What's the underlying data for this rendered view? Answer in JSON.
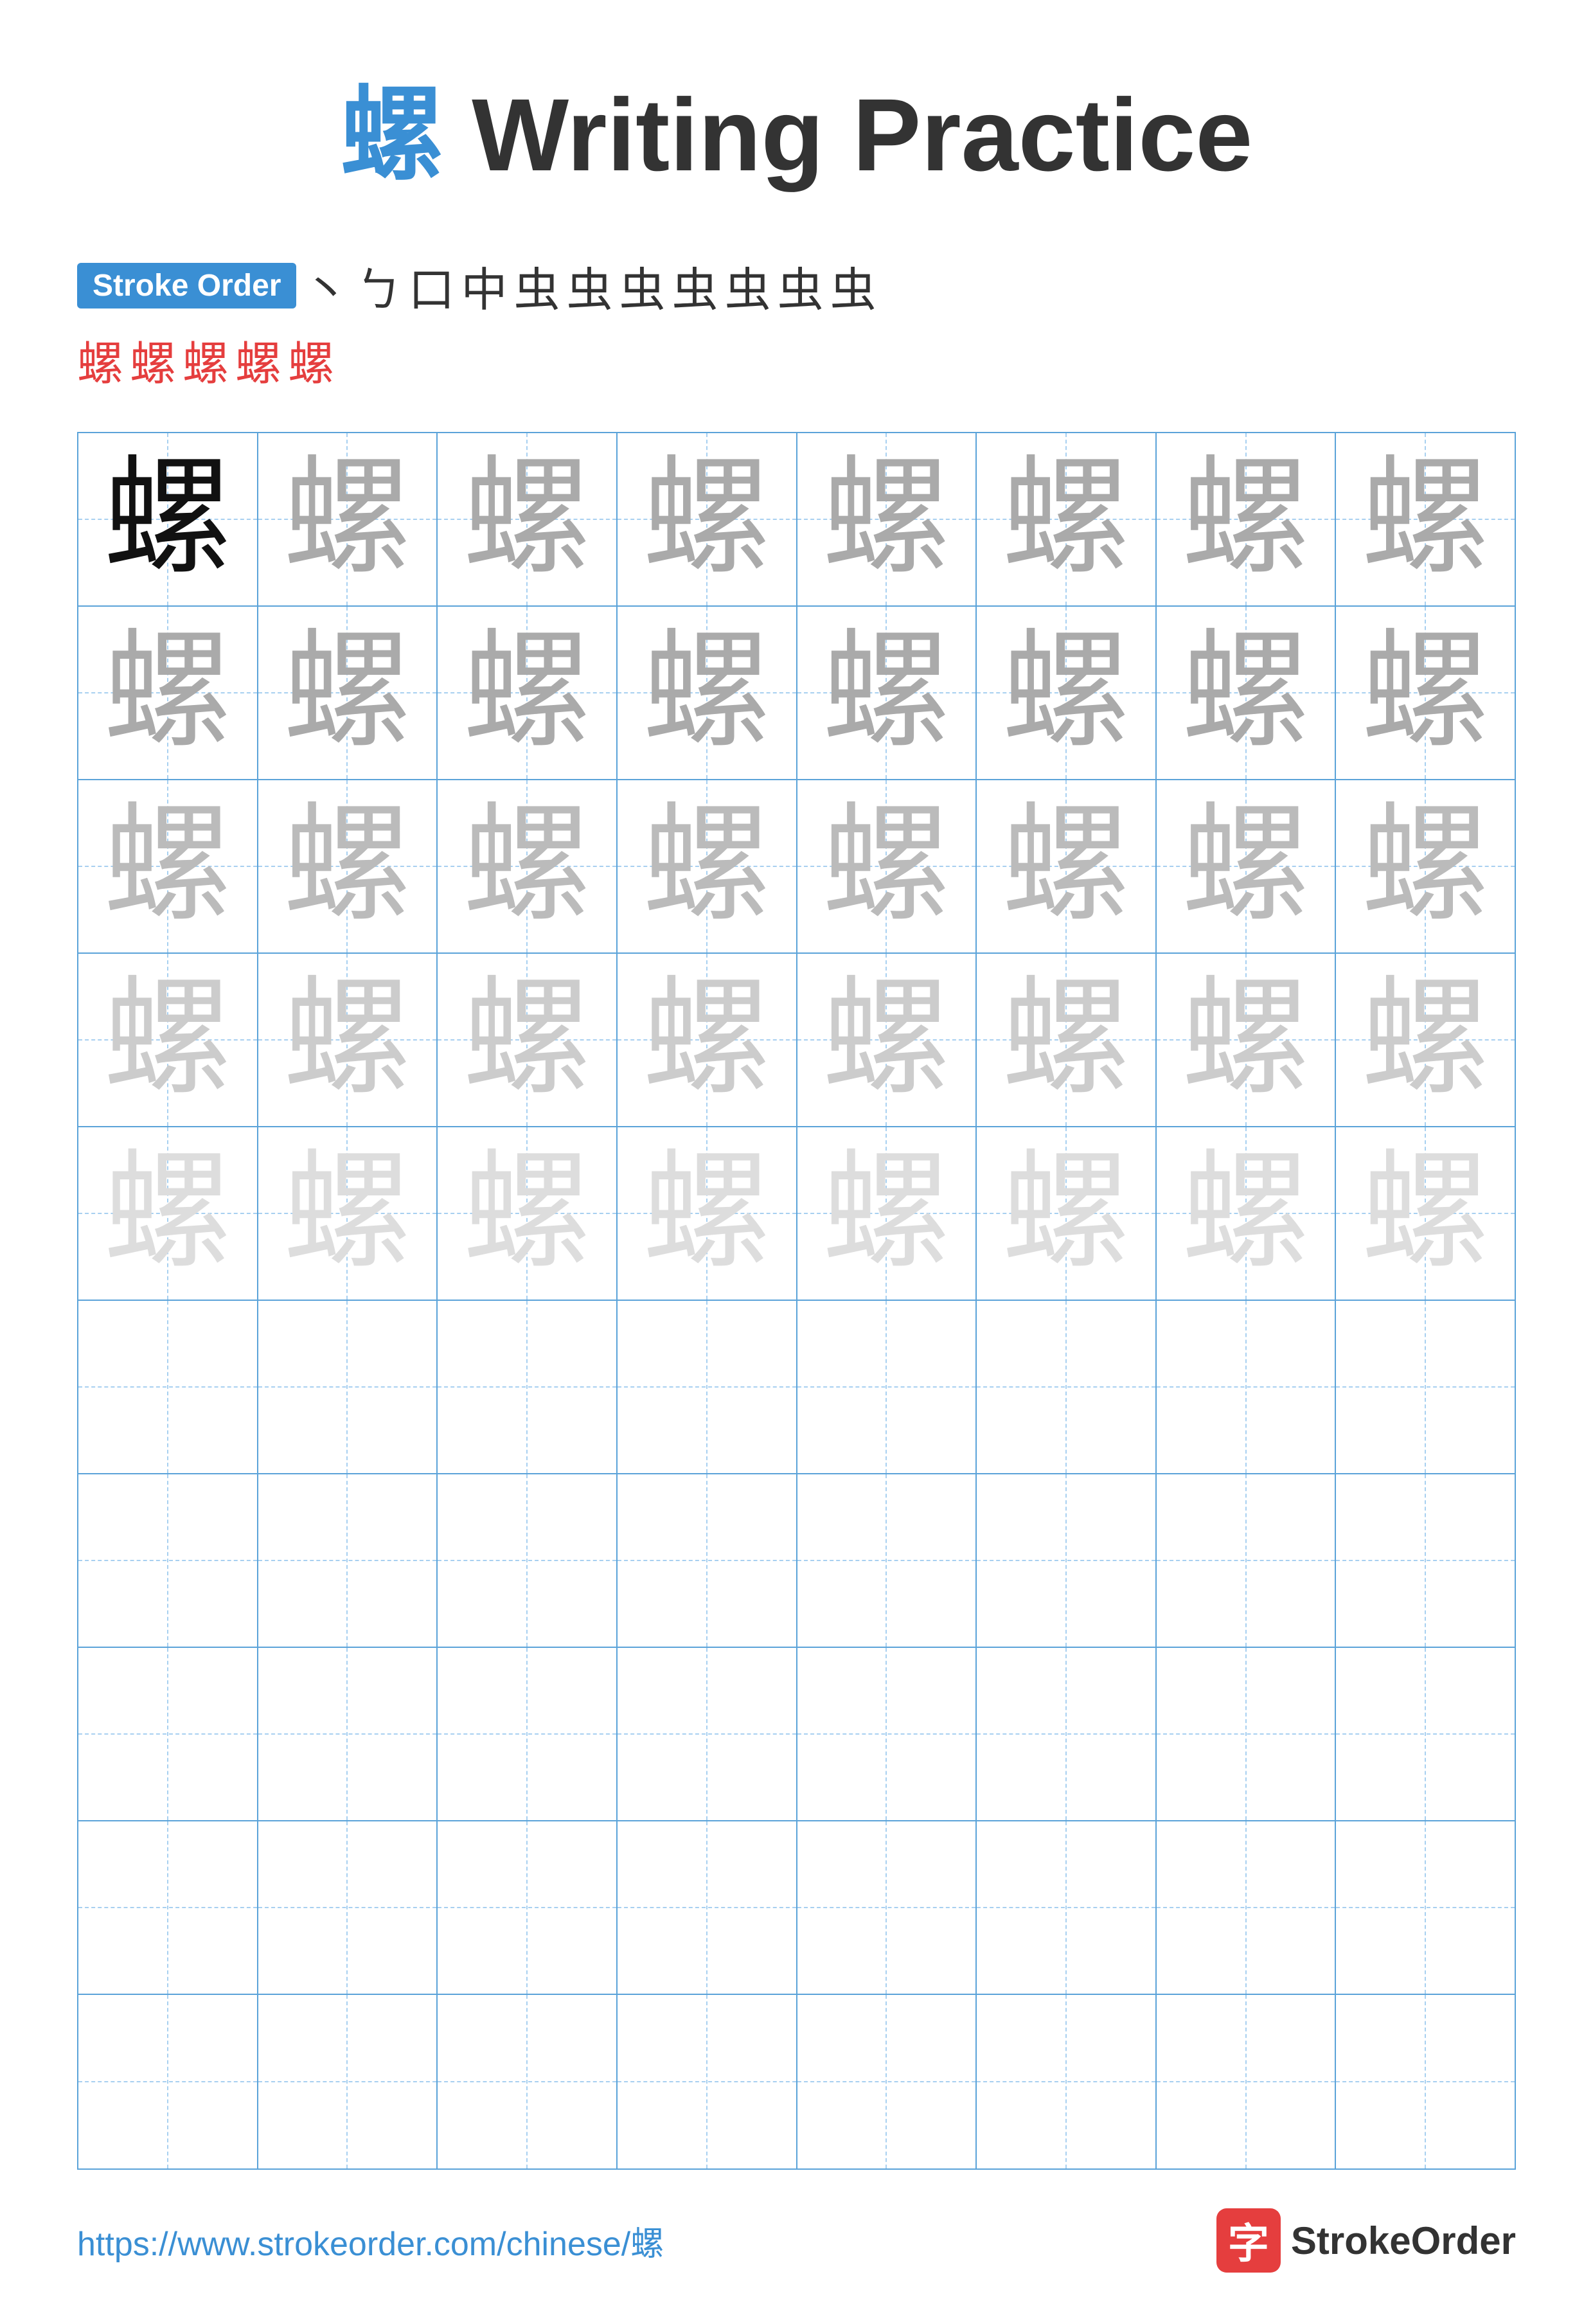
{
  "title": {
    "char": "螺",
    "text": " Writing Practice"
  },
  "stroke_order": {
    "badge_label": "Stroke Order",
    "strokes_line1": [
      "丶",
      "ㄅ",
      "口",
      "中",
      "虫",
      "虫",
      "虫",
      "虫⁻",
      "虫⁺",
      "虫⁺⁺",
      "虫⁺⁺⁺"
    ],
    "strokes_line2": [
      "螺⁻",
      "螺⁻",
      "螺⁻",
      "螺⁻",
      "螺"
    ]
  },
  "grid": {
    "rows": 10,
    "cols": 8,
    "char": "螺",
    "fill_rows": [
      [
        "dark",
        "g1",
        "g1",
        "g1",
        "g1",
        "g1",
        "g1",
        "g1"
      ],
      [
        "g1",
        "g1",
        "g1",
        "g1",
        "g1",
        "g1",
        "g1",
        "g1"
      ],
      [
        "g2",
        "g2",
        "g2",
        "g2",
        "g2",
        "g2",
        "g2",
        "g2"
      ],
      [
        "g3",
        "g3",
        "g3",
        "g3",
        "g3",
        "g3",
        "g3",
        "g3"
      ],
      [
        "g4",
        "g4",
        "g4",
        "g4",
        "g4",
        "g4",
        "g4",
        "g4"
      ],
      [
        "none",
        "none",
        "none",
        "none",
        "none",
        "none",
        "none",
        "none"
      ],
      [
        "none",
        "none",
        "none",
        "none",
        "none",
        "none",
        "none",
        "none"
      ],
      [
        "none",
        "none",
        "none",
        "none",
        "none",
        "none",
        "none",
        "none"
      ],
      [
        "none",
        "none",
        "none",
        "none",
        "none",
        "none",
        "none",
        "none"
      ],
      [
        "none",
        "none",
        "none",
        "none",
        "none",
        "none",
        "none",
        "none"
      ]
    ]
  },
  "footer": {
    "url": "https://www.strokeorder.com/chinese/螺",
    "logo_char": "字",
    "logo_text": "StrokeOrder"
  }
}
